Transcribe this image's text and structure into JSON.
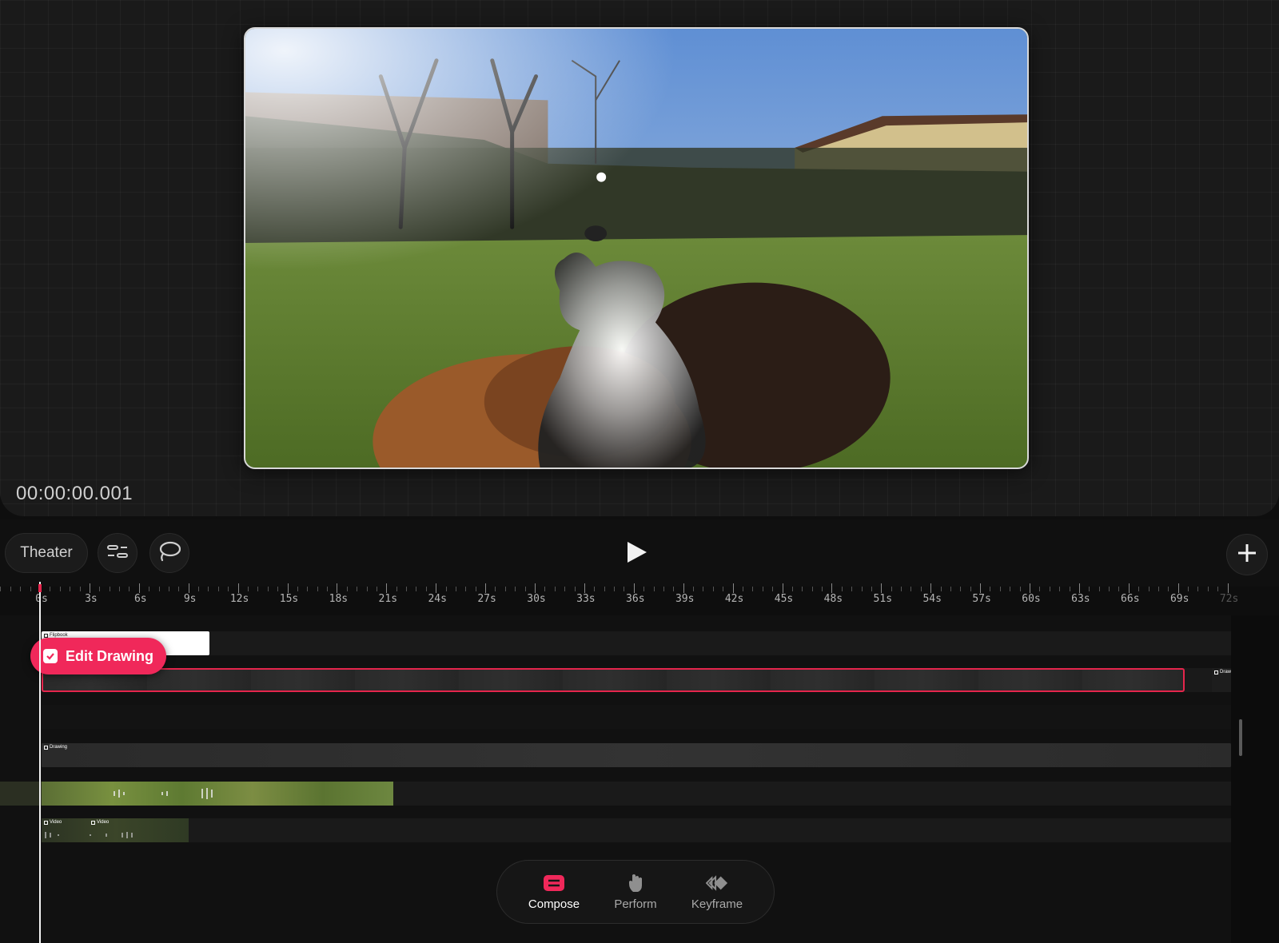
{
  "preview": {
    "timecode": "00:00:00.001"
  },
  "toolbar": {
    "theater_label": "Theater",
    "tracks_icon": "tracks-icon",
    "lasso_icon": "lasso-icon",
    "play_icon": "play-icon",
    "add_icon": "plus-icon"
  },
  "ruler": {
    "labels": [
      "0s",
      "3s",
      "6s",
      "9s",
      "12s",
      "15s",
      "18s",
      "21s",
      "24s",
      "27s",
      "30s",
      "33s",
      "36s",
      "39s",
      "42s",
      "45s",
      "48s",
      "51s",
      "54s",
      "57s",
      "60s",
      "63s",
      "66s",
      "69s",
      "72s"
    ],
    "dim_last": true
  },
  "timeline": {
    "flipbook_label": "Flipbook",
    "drawing_label_right": "Drawing",
    "drawing_label_lane": "Drawing",
    "video_label_1": "Video",
    "video_label_2": "Video",
    "edit_drawing_label": "Edit Drawing"
  },
  "modes": [
    {
      "label": "Compose",
      "icon": "compose-icon",
      "active": true
    },
    {
      "label": "Perform",
      "icon": "hand-icon",
      "active": false
    },
    {
      "label": "Keyframe",
      "icon": "keyframe-icon",
      "active": false
    }
  ],
  "colors": {
    "accent": "#f0285a",
    "selection_border": "#e5254c"
  }
}
